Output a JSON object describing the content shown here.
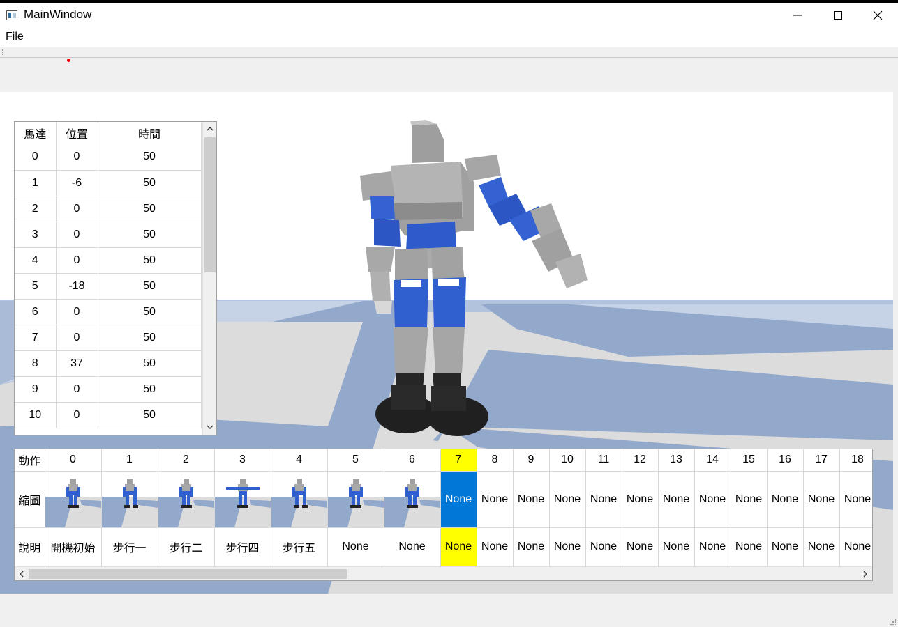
{
  "window": {
    "title": "MainWindow"
  },
  "menu": {
    "file": "File"
  },
  "colors": {
    "floor_blue": "#93a9cc",
    "floor_light": "#dcdcdc",
    "robot_blue": "#3060d0",
    "robot_gray": "#a9a9a9",
    "selection_blue": "#0078d7",
    "highlight_yellow": "#ffff00"
  },
  "motor_table": {
    "headers": [
      "馬達",
      "位置",
      "時間"
    ],
    "rows": [
      [
        "0",
        "0",
        "50"
      ],
      [
        "1",
        "-6",
        "50"
      ],
      [
        "2",
        "0",
        "50"
      ],
      [
        "3",
        "0",
        "50"
      ],
      [
        "4",
        "0",
        "50"
      ],
      [
        "5",
        "-18",
        "50"
      ],
      [
        "6",
        "0",
        "50"
      ],
      [
        "7",
        "0",
        "50"
      ],
      [
        "8",
        "37",
        "50"
      ],
      [
        "9",
        "0",
        "50"
      ],
      [
        "10",
        "0",
        "50"
      ]
    ]
  },
  "action_table": {
    "row_labels": [
      "動作",
      "縮圖",
      "說明"
    ],
    "columns": [
      "0",
      "1",
      "2",
      "3",
      "4",
      "5",
      "6",
      "7",
      "8",
      "9",
      "10",
      "11",
      "12",
      "13",
      "14",
      "15",
      "16",
      "17",
      "18"
    ],
    "thumbs": [
      "",
      "",
      "",
      "",
      "",
      "",
      "",
      "None",
      "None",
      "None",
      "None",
      "None",
      "None",
      "None",
      "None",
      "None",
      "None",
      "None",
      "None"
    ],
    "descriptions": [
      "開機初始",
      "步行一",
      "步行二",
      "步行四",
      "步行五",
      "None",
      "None",
      "None",
      "None",
      "None",
      "None",
      "None",
      "None",
      "None",
      "None",
      "None",
      "None",
      "None",
      "None"
    ],
    "selected_column": "7"
  },
  "icons": [
    "app-icon",
    "minimize-icon",
    "maximize-icon",
    "close-icon",
    "scroll-up-icon",
    "scroll-down-icon",
    "scroll-left-icon",
    "scroll-right-icon",
    "resize-grip-icon"
  ]
}
